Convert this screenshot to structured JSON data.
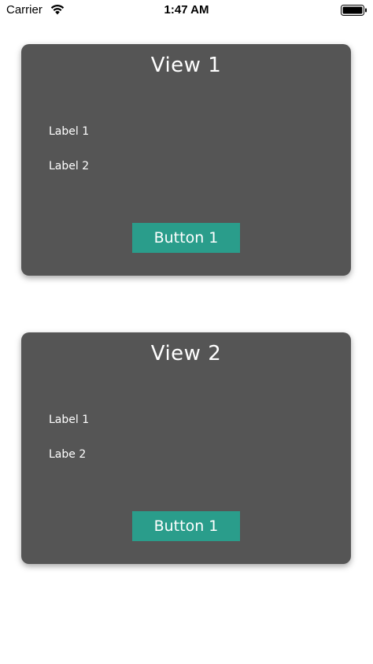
{
  "status_bar": {
    "carrier": "Carrier",
    "time": "1:47 AM",
    "wifi_icon": "wifi-icon",
    "battery_icon": "battery-icon"
  },
  "views": [
    {
      "title": "View 1",
      "label_1": "Label 1",
      "label_2": "Label 2",
      "button_label": "Button 1"
    },
    {
      "title": "View 2",
      "label_1": "Label 1",
      "label_2": "Labe 2",
      "button_label": "Button 1"
    }
  ],
  "colors": {
    "card_background": "#555555",
    "button_background": "#2a9d8b",
    "text": "#ffffff"
  }
}
